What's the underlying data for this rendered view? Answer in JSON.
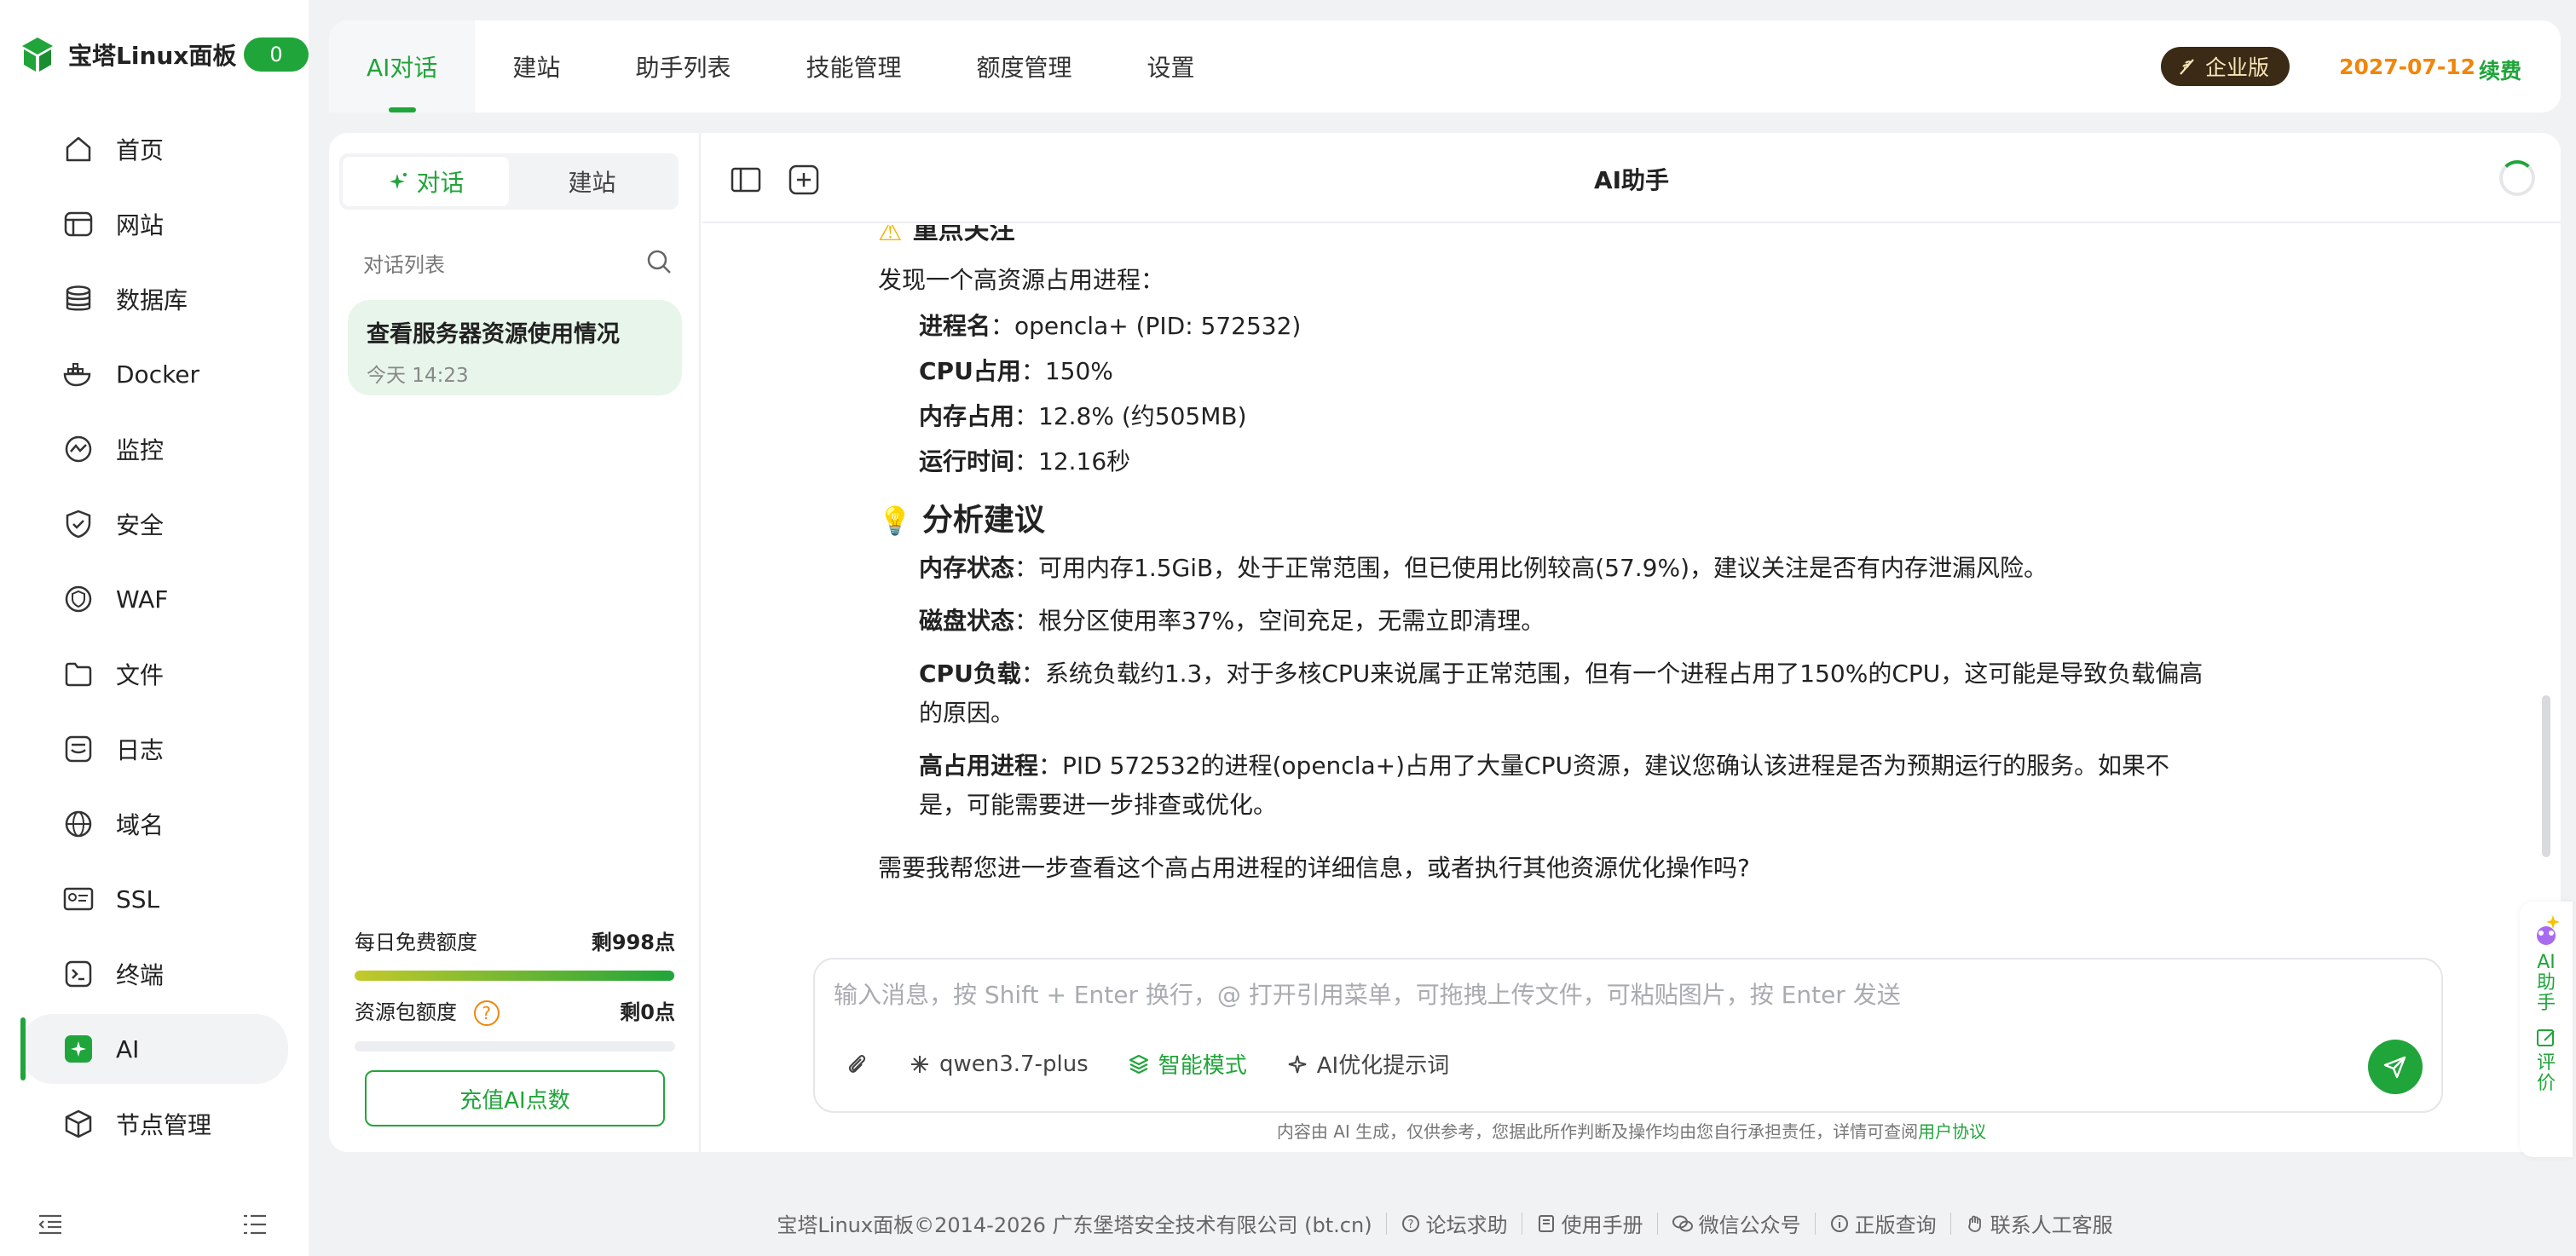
{
  "brand": {
    "title": "宝塔Linux面板",
    "badge": "0"
  },
  "nav": {
    "items": [
      {
        "label": "首页",
        "icon": "home-icon"
      },
      {
        "label": "网站",
        "icon": "globe-window-icon"
      },
      {
        "label": "数据库",
        "icon": "database-icon"
      },
      {
        "label": "Docker",
        "icon": "docker-icon"
      },
      {
        "label": "监控",
        "icon": "monitor-icon"
      },
      {
        "label": "安全",
        "icon": "shield-icon"
      },
      {
        "label": "WAF",
        "icon": "waf-icon"
      },
      {
        "label": "文件",
        "icon": "folder-icon"
      },
      {
        "label": "日志",
        "icon": "log-icon"
      },
      {
        "label": "域名",
        "icon": "domain-icon"
      },
      {
        "label": "SSL",
        "icon": "ssl-icon"
      },
      {
        "label": "终端",
        "icon": "terminal-icon"
      },
      {
        "label": "AI",
        "icon": "ai-icon",
        "active": true
      },
      {
        "label": "节点管理",
        "icon": "cube-icon"
      }
    ]
  },
  "topbar": {
    "tabs": [
      "AI对话",
      "建站",
      "助手列表",
      "技能管理",
      "额度管理",
      "设置"
    ],
    "active_tab": "AI对话",
    "edition": "企业版",
    "expiry": "2027-07-12",
    "renew": "续费"
  },
  "conv_panel": {
    "segments": [
      "对话",
      "建站"
    ],
    "list_title": "对话列表",
    "items": [
      {
        "title": "查看服务器资源使用情况",
        "time": "今天 14:23"
      }
    ],
    "daily_quota": {
      "label": "每日免费额度",
      "value": "剩998点",
      "fraction": 0.998
    },
    "pack_quota": {
      "label": "资源包额度",
      "value": "剩0点",
      "fraction": 0,
      "help": "?"
    },
    "recharge": "充值AI点数"
  },
  "chat": {
    "title": "AI助手",
    "section1_title": "重点关注",
    "intro": "发现一个高资源占用进程：",
    "process": [
      {
        "k": "进程名",
        "v": "：opencla+ (PID: 572532)"
      },
      {
        "k": "CPU占用",
        "v": "：150%"
      },
      {
        "k": "内存占用",
        "v": "：12.8% (约505MB)"
      },
      {
        "k": "运行时间",
        "v": "：12.16秒"
      }
    ],
    "section2_title": "分析建议",
    "advice": [
      {
        "k": "内存状态",
        "v": "：可用内存1.5GiB，处于正常范围，但已使用比例较高(57.9%)，建议关注是否有内存泄漏风险。"
      },
      {
        "k": "磁盘状态",
        "v": "：根分区使用率37%，空间充足，无需立即清理。"
      },
      {
        "k": "CPU负载",
        "v": "：系统负载约1.3，对于多核CPU来说属于正常范围，但有一个进程占用了150%的CPU，这可能是导致负载偏高的原因。"
      },
      {
        "k": "高占用进程",
        "v": "：PID 572532的进程(opencla+)占用了大量CPU资源，建议您确认该进程是否为预期运行的服务。如果不是，可能需要进一步排查或优化。"
      }
    ],
    "closing": "需要我帮您进一步查看这个高占用进程的详细信息，或者执行其他资源优化操作吗?",
    "composer_placeholder": "输入消息，按 Shift + Enter 换行，@ 打开引用菜单，可拖拽上传文件，可粘贴图片，按 Enter 发送",
    "model": "qwen3.7-plus",
    "mode": "智能模式",
    "optimize": "AI优化提示词",
    "disclaimer": "内容由 AI 生成，仅供参考，您据此所作判断及操作均由您自行承担责任，详情可查阅",
    "agreement": "用户协议"
  },
  "float_ai": {
    "label": "AI助手",
    "review": "评价"
  },
  "footer": {
    "copyright": "宝塔Linux面板©2014-2026 广东堡塔安全技术有限公司 (bt.cn)",
    "links": [
      "论坛求助",
      "使用手册",
      "微信公众号",
      "正版查询",
      "联系人工客服"
    ]
  },
  "colors": {
    "accent": "#20a53a",
    "warning": "#f0860a",
    "edition_bg": "#3b2a15"
  }
}
